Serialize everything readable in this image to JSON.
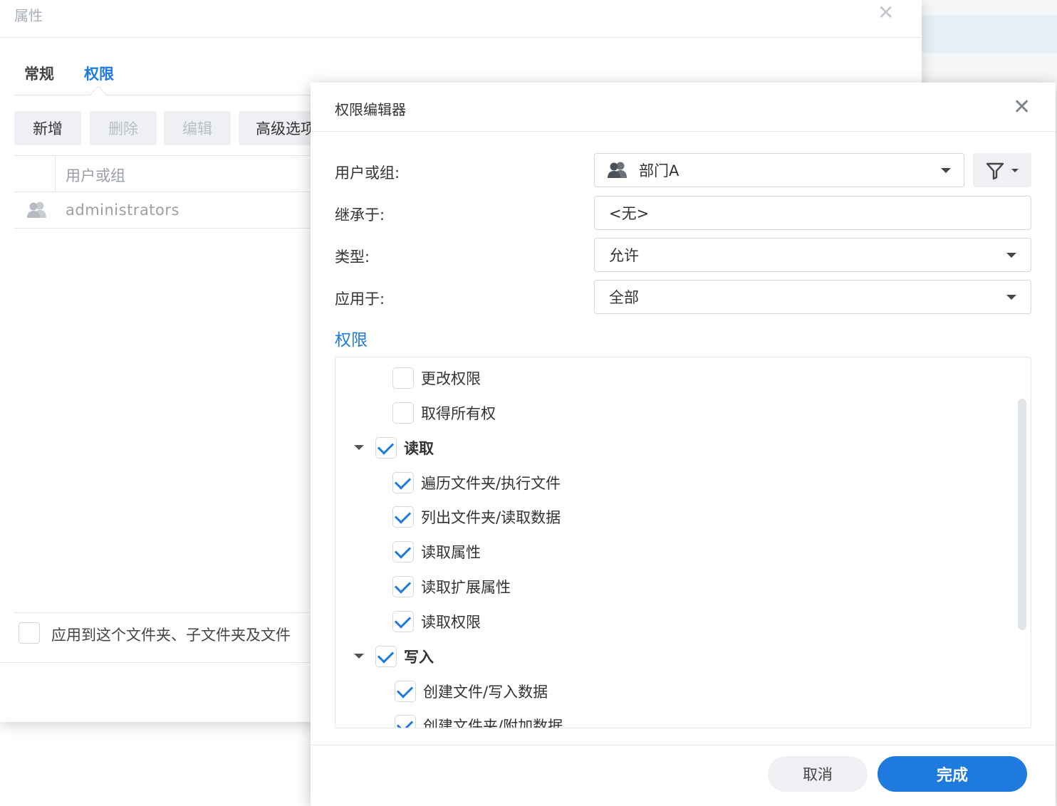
{
  "properties": {
    "title": "属性",
    "tabs": [
      {
        "label": "常规"
      },
      {
        "label": "权限"
      }
    ],
    "toolbar": {
      "add": "新增",
      "delete": "删除",
      "edit": "编辑",
      "advanced": "高级选项"
    },
    "grid": {
      "column_header": "用户或组",
      "rows": [
        {
          "name": "administrators"
        }
      ]
    },
    "apply_label": "应用到这个文件夹、子文件夹及文件"
  },
  "editor": {
    "title": "权限编辑器",
    "fields": {
      "user_or_group": {
        "label": "用户或组:",
        "value": "部门A"
      },
      "inherited_from": {
        "label": "继承于:",
        "value": "<无>"
      },
      "type": {
        "label": "类型:",
        "value": "允许"
      },
      "apply_to": {
        "label": "应用于:",
        "value": "全部"
      }
    },
    "permissions_title": "权限",
    "permissions": [
      {
        "label": "更改权限",
        "checked": false
      },
      {
        "label": "取得所有权",
        "checked": false
      },
      {
        "label": "读取",
        "checked": true,
        "group": true
      },
      {
        "label": "遍历文件夹/执行文件",
        "checked": true
      },
      {
        "label": "列出文件夹/读取数据",
        "checked": true
      },
      {
        "label": "读取属性",
        "checked": true
      },
      {
        "label": "读取扩展属性",
        "checked": true
      },
      {
        "label": "读取权限",
        "checked": true
      },
      {
        "label": "写入",
        "checked": true,
        "group": true
      },
      {
        "label": "创建文件/写入数据",
        "checked": true
      },
      {
        "label": "创建文件夹/附加数据",
        "checked": true
      }
    ],
    "buttons": {
      "cancel": "取消",
      "done": "完成"
    }
  },
  "colors": {
    "accent": "#1f7ae0"
  }
}
